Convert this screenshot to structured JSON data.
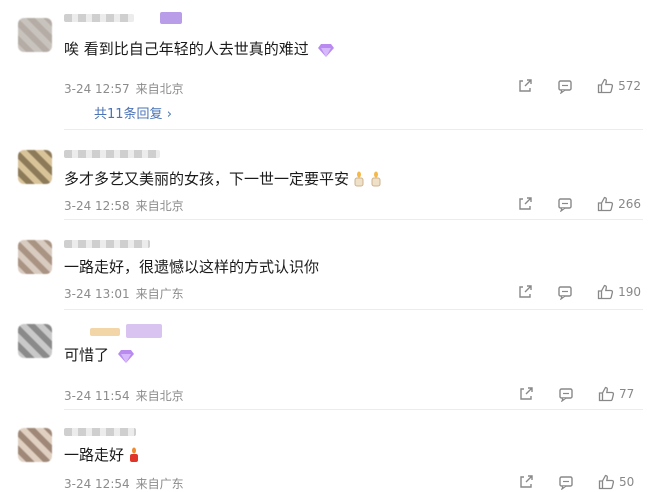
{
  "comments": [
    {
      "text": "唉 看到比自己年轻的人去世真的难过",
      "date": "3-24 12:57",
      "location": "来自北京",
      "likes": "572",
      "replies_label": "共11条回复"
    },
    {
      "text": "多才多艺又美丽的女孩，下一世一定要平安",
      "date": "3-24 12:58",
      "location": "来自北京",
      "likes": "266"
    },
    {
      "text": "一路走好，很遗憾以这样的方式认识你",
      "date": "3-24 13:01",
      "location": "来自广东",
      "likes": "190"
    },
    {
      "text": "可惜了",
      "date": "3-24 11:54",
      "location": "来自北京",
      "likes": "77"
    },
    {
      "text": "一路走好",
      "date": "3-24 12:54",
      "location": "来自广东",
      "likes": "50"
    }
  ],
  "icons": {
    "share": "share-icon",
    "comment": "comment-icon",
    "like": "thumbs-up-icon",
    "gem": "purple-diamond-icon",
    "candle": "candle-emoji",
    "reply_arrow": "chevron-right-icon"
  },
  "colors": {
    "link": "#4a73b5",
    "meta": "#8c8c8c",
    "badge": "#b99de8"
  }
}
